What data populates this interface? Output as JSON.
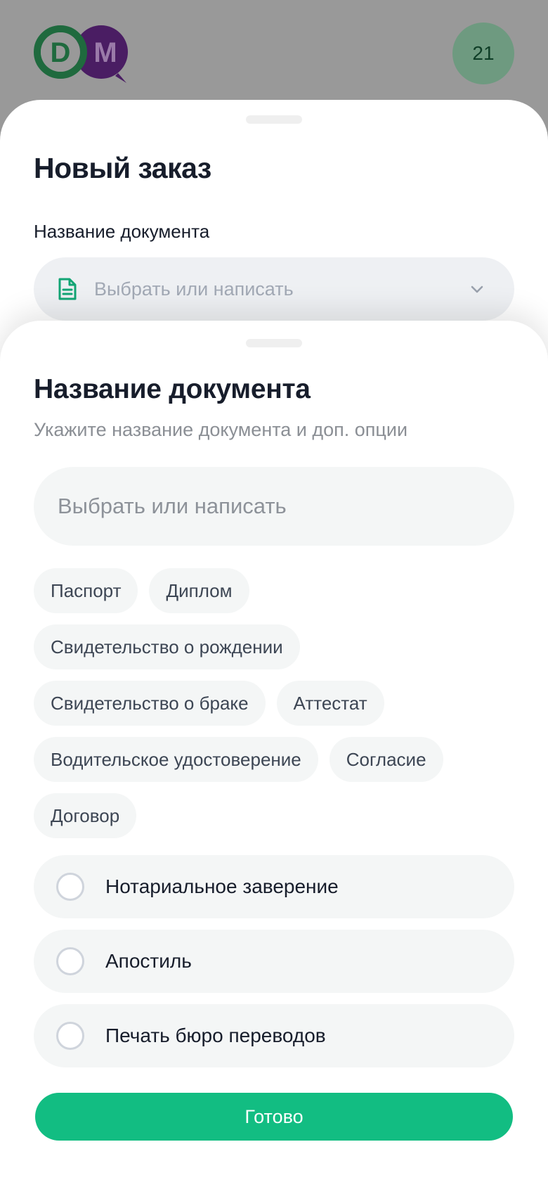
{
  "header": {
    "logo_text": "DM",
    "badge_count": "21"
  },
  "order_sheet": {
    "title": "Новый заказ",
    "document_label": "Название документа",
    "document_placeholder": "Выбрать или написать"
  },
  "document_sheet": {
    "title": "Название документа",
    "subtitle": "Укажите название документа и доп. опции",
    "input_placeholder": "Выбрать или написать",
    "chips": [
      "Паспорт",
      "Диплом",
      "Свидетельство о рождении",
      "Свидетельство о браке",
      "Аттестат",
      "Водительское удостоверение",
      "Согласие",
      "Договор"
    ],
    "options": [
      {
        "label": "Нотариальное заверение",
        "checked": false
      },
      {
        "label": "Апостиль",
        "checked": false
      },
      {
        "label": "Печать бюро переводов",
        "checked": false
      }
    ],
    "done_label": "Готово"
  },
  "colors": {
    "brand_green": "#12bd82",
    "logo_green": "#1f6a3e",
    "logo_purple": "#4a1d63",
    "text_dark": "#171d2b",
    "chip_bg": "#f4f6f6"
  },
  "icons": {
    "document": "document-icon",
    "chevron": "chevron-down-icon",
    "radio": "radio-unchecked-icon"
  }
}
